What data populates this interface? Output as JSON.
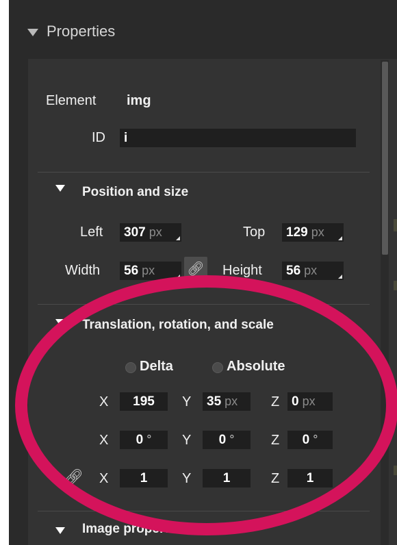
{
  "panel": {
    "title": "Properties"
  },
  "element_row": {
    "label": "Element",
    "value": "img"
  },
  "id_row": {
    "label": "ID",
    "value": "i"
  },
  "position_section": {
    "title": "Position and size",
    "left": {
      "label": "Left",
      "value": "307",
      "unit": "px"
    },
    "top": {
      "label": "Top",
      "value": "129",
      "unit": "px"
    },
    "width": {
      "label": "Width",
      "value": "56",
      "unit": "px"
    },
    "height": {
      "label": "Height",
      "value": "56",
      "unit": "px"
    }
  },
  "transform_section": {
    "title": "Translation, rotation, and scale",
    "mode_options": [
      "Delta",
      "Absolute"
    ],
    "translate": {
      "x": {
        "label": "X",
        "value": "195",
        "unit": ""
      },
      "y": {
        "label": "Y",
        "value": "35",
        "unit": "px"
      },
      "z": {
        "label": "Z",
        "value": "0",
        "unit": "px"
      }
    },
    "rotate": {
      "x": {
        "label": "X",
        "value": "0",
        "unit": "°"
      },
      "y": {
        "label": "Y",
        "value": "0",
        "unit": "°"
      },
      "z": {
        "label": "Z",
        "value": "0",
        "unit": "°"
      }
    },
    "scale": {
      "x": {
        "label": "X",
        "value": "1"
      },
      "y": {
        "label": "Y",
        "value": "1"
      },
      "z": {
        "label": "Z",
        "value": "1"
      }
    }
  },
  "image_section": {
    "title": "Image properties"
  },
  "colors": {
    "annotation_oval": "#d4135b",
    "panel_bg": "#2a2a2a",
    "field_bg": "#1f1f1f"
  },
  "icons": {
    "collapse": "triangle-down",
    "link": "chain-link"
  }
}
